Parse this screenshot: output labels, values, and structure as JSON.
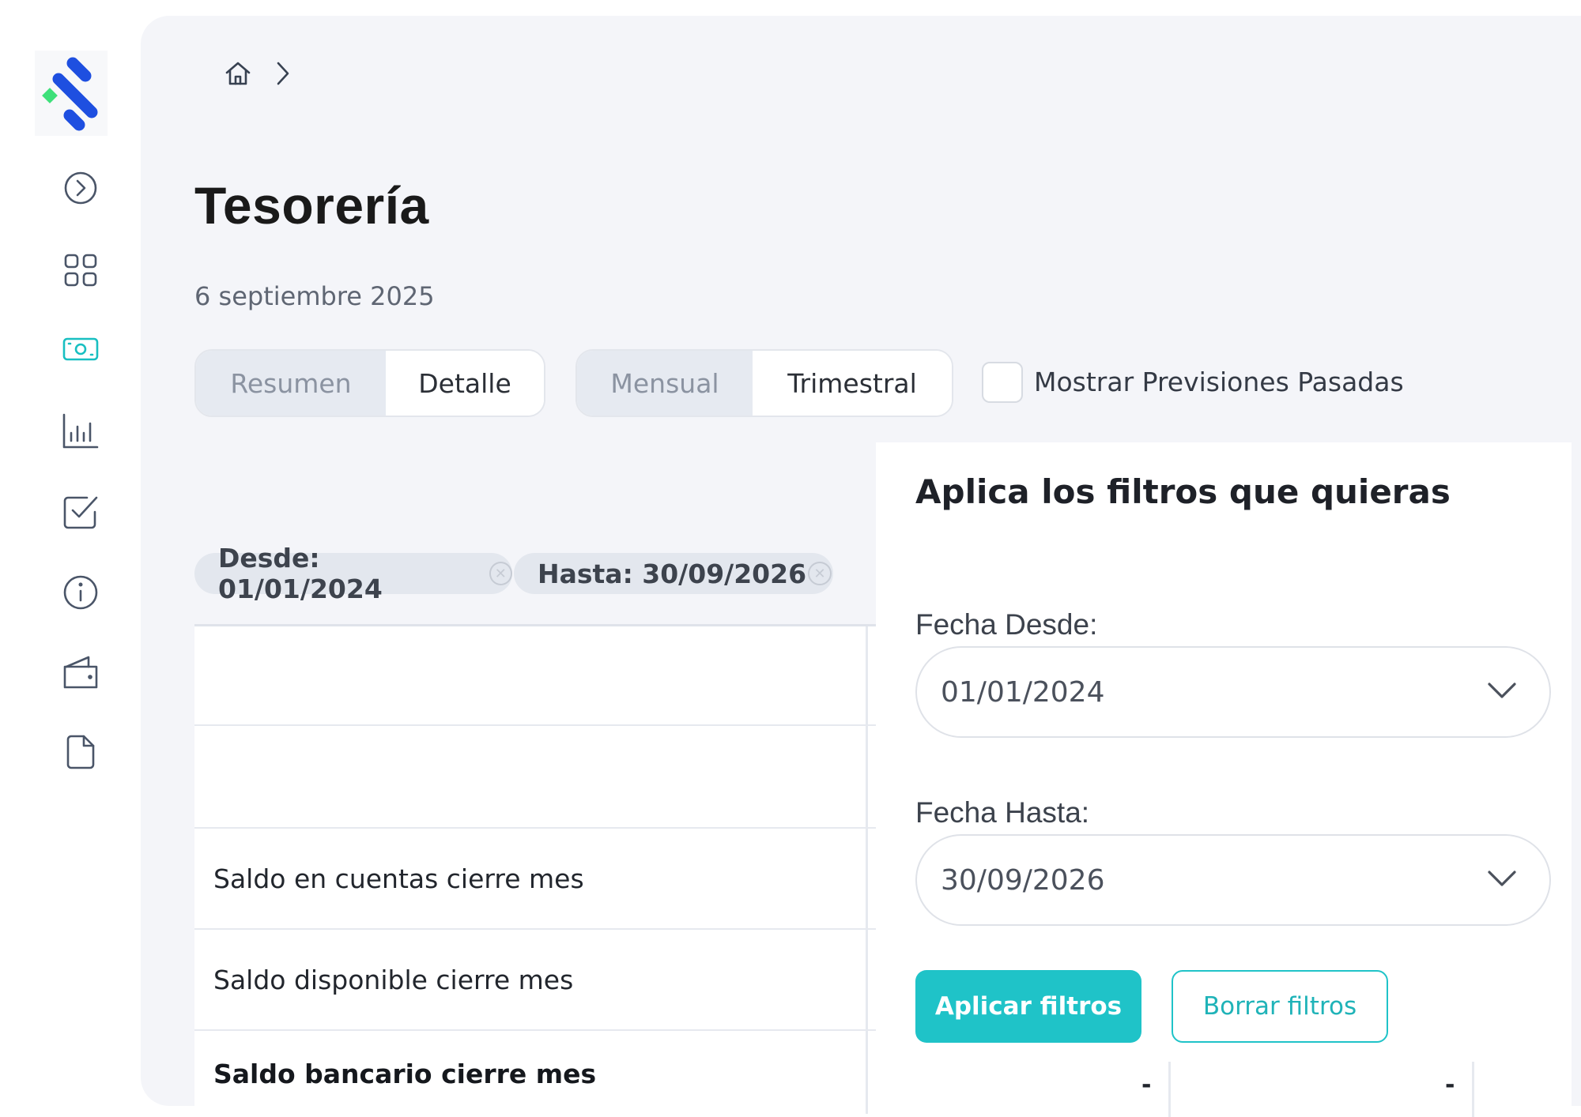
{
  "sidebar": {
    "items": [
      {
        "icon": "chevron-right-circle-icon",
        "active": false
      },
      {
        "icon": "dashboard-grid-icon",
        "active": false
      },
      {
        "icon": "banknote-icon",
        "active": true
      },
      {
        "icon": "bar-chart-icon",
        "active": false
      },
      {
        "icon": "check-square-icon",
        "active": false
      },
      {
        "icon": "info-icon",
        "active": false
      },
      {
        "icon": "wallet-icon",
        "active": false
      },
      {
        "icon": "document-icon",
        "active": false
      }
    ]
  },
  "colors": {
    "accent": "#1fc3c8",
    "logo_blue": "#1e4fe0",
    "logo_green": "#3ee07a"
  },
  "breadcrumb": {
    "home_icon": "home-icon",
    "separator_icon": "chevron-right-icon"
  },
  "header": {
    "title": "Tesorería",
    "date": "6 septiembre 2025"
  },
  "view_toggle": {
    "options": [
      "Resumen",
      "Detalle"
    ],
    "selected": "Resumen"
  },
  "period_toggle": {
    "options": [
      "Mensual",
      "Trimestral"
    ],
    "selected": "Mensual"
  },
  "show_past": {
    "label": "Mostrar Previsiones Pasadas",
    "checked": false
  },
  "active_filters": [
    {
      "label": "Desde: 01/01/2024"
    },
    {
      "label": "Hasta: 30/09/2026"
    }
  ],
  "table": {
    "rows": [
      {
        "label": ""
      },
      {
        "label": ""
      },
      {
        "label": "Saldo en cuentas cierre mes"
      },
      {
        "label": "Saldo disponible cierre mes"
      },
      {
        "label": "Saldo bancario cierre mes",
        "values": [
          "-",
          "-"
        ]
      }
    ]
  },
  "filter_panel": {
    "title": "Aplica los filtros que quieras",
    "from_label": "Fecha Desde:",
    "from_value": "01/01/2024",
    "to_label": "Fecha Hasta:",
    "to_value": "30/09/2026",
    "apply_label": "Aplicar filtros",
    "clear_label": "Borrar filtros"
  }
}
